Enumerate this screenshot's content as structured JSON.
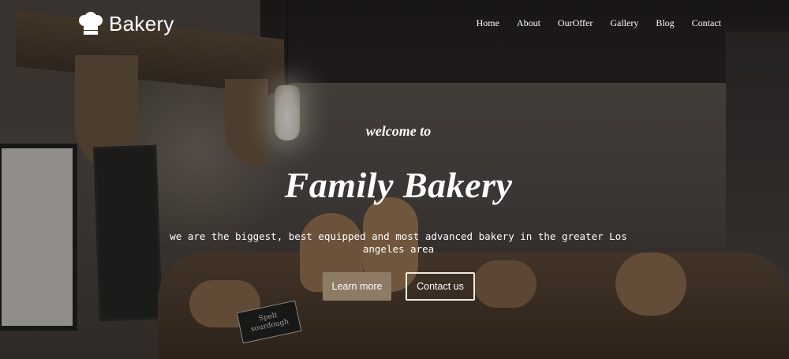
{
  "brand": {
    "name": "Bakery",
    "icon": "chef-hat-icon"
  },
  "nav": {
    "items": [
      {
        "label": "Home"
      },
      {
        "label": "About"
      },
      {
        "label": "OurOffer"
      },
      {
        "label": "Gallery"
      },
      {
        "label": "Blog"
      },
      {
        "label": "Contact"
      }
    ]
  },
  "hero": {
    "welcome": "welcome to",
    "title": "Family Bakery",
    "tagline": "we are the biggest, best equipped and most advanced bakery in the greater Los angeles area",
    "learn_more": "Learn more",
    "contact_us": "Contact us",
    "label_card": "Spelt sourdough"
  },
  "colors": {
    "accent_button": "#8e7b65",
    "text": "#ffffff"
  }
}
